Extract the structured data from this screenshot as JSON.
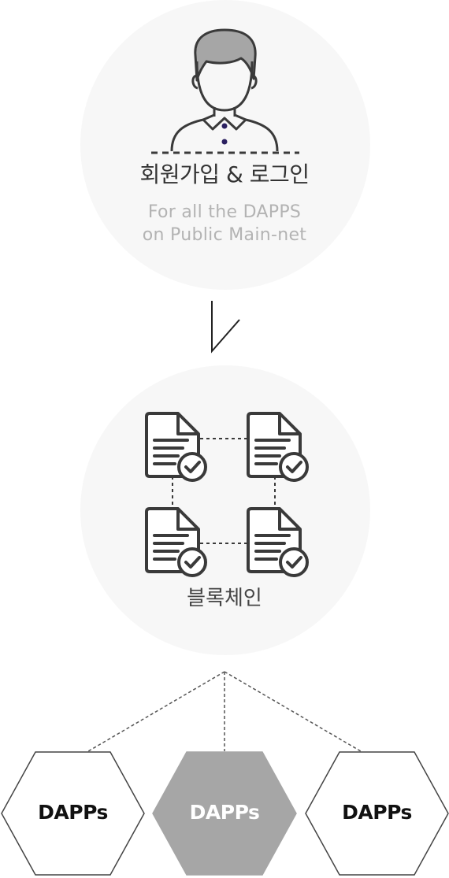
{
  "signup": {
    "title": "회원가입 & 로그인",
    "subtitle_line1": "For all the DAPPS",
    "subtitle_line2": "on Public Main-net"
  },
  "blockchain": {
    "title": "블록체인"
  },
  "dapps": [
    {
      "label": "DAPPs",
      "highlighted": false
    },
    {
      "label": "DAPPs",
      "highlighted": true
    },
    {
      "label": "DAPPs",
      "highlighted": false
    }
  ],
  "colors": {
    "circle_bg": "#f7f7f7",
    "icon_stroke": "#3a3a3a",
    "hair": "#a6a6a6",
    "button_dot": "#2b2060",
    "hex_fill_highlight": "#a6a6a6",
    "hex_text": "#111111",
    "hex_text_highlight": "#ffffff"
  },
  "icons": {
    "user": "user-icon",
    "document": "verified-document-icon",
    "arrow": "arrow-down-icon"
  }
}
